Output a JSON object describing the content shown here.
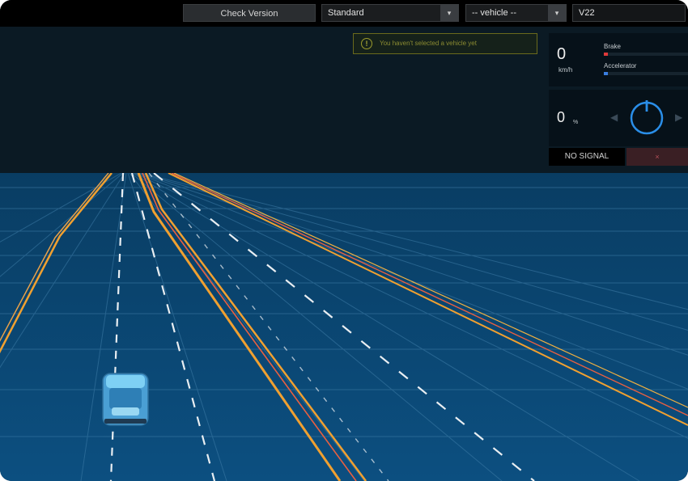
{
  "toolbar": {
    "check_version_label": "Check Version",
    "mode_select": {
      "value": "Standard",
      "caret": "▾"
    },
    "vehicle_select": {
      "value": "-- vehicle --",
      "caret": "▾"
    },
    "version_input": {
      "value": "V22"
    }
  },
  "warning": {
    "icon": "warning-icon",
    "icon_glyph": "!",
    "text": "You haven't selected a vehicle yet"
  },
  "speed": {
    "value": "0",
    "unit": "km/h",
    "brake_label": "Brake",
    "brake_level": 0.05,
    "accelerator_label": "Accelerator",
    "accelerator_level": 0.05
  },
  "steering": {
    "value": "0",
    "unit": "%",
    "left_arrow": "◀",
    "right_arrow": "▶"
  },
  "signal": {
    "label": "NO SIGNAL",
    "button_label": "×"
  },
  "colors": {
    "road_background": "#0b4a78",
    "grid_line": "#3f7da8",
    "lane_line": "#e9eef2",
    "boundary_orange": "#f0a030",
    "boundary_red": "#e86040",
    "brake": "#e03a3a",
    "accelerator": "#3a7ee0",
    "steering_ring": "#2a8ee8",
    "vehicle": "#5ab4e6"
  }
}
